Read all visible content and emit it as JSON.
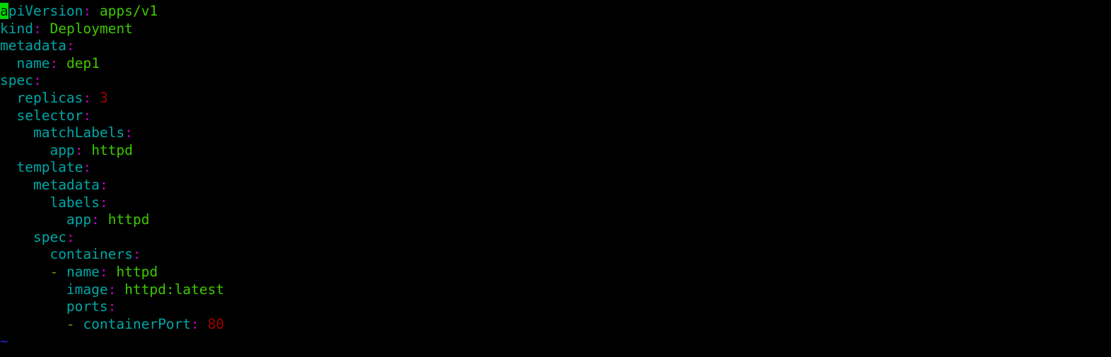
{
  "editor": {
    "name": "vim-yaml-buffer",
    "background": "#000000",
    "cursor_color": "#00d900",
    "colors": {
      "key": "#00a6a6",
      "punctuation": "#c000c0",
      "string": "#3fc700",
      "number": "#9e0000",
      "dash": "#8a8a00",
      "tilde": "#2222cc"
    },
    "cursor": {
      "line": 1,
      "column": 1,
      "character": "a"
    },
    "empty_line_marker": "~",
    "lines": [
      {
        "indent": "",
        "dash": "",
        "key": "apiVersion",
        "colon": ":",
        "space": " ",
        "value": "apps/v1",
        "value_type": "string"
      },
      {
        "indent": "",
        "dash": "",
        "key": "kind",
        "colon": ":",
        "space": " ",
        "value": "Deployment",
        "value_type": "string"
      },
      {
        "indent": "",
        "dash": "",
        "key": "metadata",
        "colon": ":",
        "space": "",
        "value": "",
        "value_type": "none"
      },
      {
        "indent": "  ",
        "dash": "",
        "key": "name",
        "colon": ":",
        "space": " ",
        "value": "dep1",
        "value_type": "string"
      },
      {
        "indent": "",
        "dash": "",
        "key": "spec",
        "colon": ":",
        "space": "",
        "value": "",
        "value_type": "none"
      },
      {
        "indent": "  ",
        "dash": "",
        "key": "replicas",
        "colon": ":",
        "space": " ",
        "value": "3",
        "value_type": "number"
      },
      {
        "indent": "  ",
        "dash": "",
        "key": "selector",
        "colon": ":",
        "space": "",
        "value": "",
        "value_type": "none"
      },
      {
        "indent": "    ",
        "dash": "",
        "key": "matchLabels",
        "colon": ":",
        "space": "",
        "value": "",
        "value_type": "none"
      },
      {
        "indent": "      ",
        "dash": "",
        "key": "app",
        "colon": ":",
        "space": " ",
        "value": "httpd",
        "value_type": "string"
      },
      {
        "indent": "  ",
        "dash": "",
        "key": "template",
        "colon": ":",
        "space": "",
        "value": "",
        "value_type": "none"
      },
      {
        "indent": "    ",
        "dash": "",
        "key": "metadata",
        "colon": ":",
        "space": "",
        "value": "",
        "value_type": "none"
      },
      {
        "indent": "      ",
        "dash": "",
        "key": "labels",
        "colon": ":",
        "space": "",
        "value": "",
        "value_type": "none"
      },
      {
        "indent": "        ",
        "dash": "",
        "key": "app",
        "colon": ":",
        "space": " ",
        "value": "httpd",
        "value_type": "string"
      },
      {
        "indent": "    ",
        "dash": "",
        "key": "spec",
        "colon": ":",
        "space": "",
        "value": "",
        "value_type": "none"
      },
      {
        "indent": "      ",
        "dash": "",
        "key": "containers",
        "colon": ":",
        "space": "",
        "value": "",
        "value_type": "none"
      },
      {
        "indent": "      ",
        "dash": "- ",
        "key": "name",
        "colon": ":",
        "space": " ",
        "value": "httpd",
        "value_type": "string"
      },
      {
        "indent": "        ",
        "dash": "",
        "key": "image",
        "colon": ":",
        "space": " ",
        "value": "httpd:latest",
        "value_type": "string"
      },
      {
        "indent": "        ",
        "dash": "",
        "key": "ports",
        "colon": ":",
        "space": "",
        "value": "",
        "value_type": "none"
      },
      {
        "indent": "        ",
        "dash": "- ",
        "key": "containerPort",
        "colon": ":",
        "space": " ",
        "value": "80",
        "value_type": "number"
      }
    ]
  }
}
